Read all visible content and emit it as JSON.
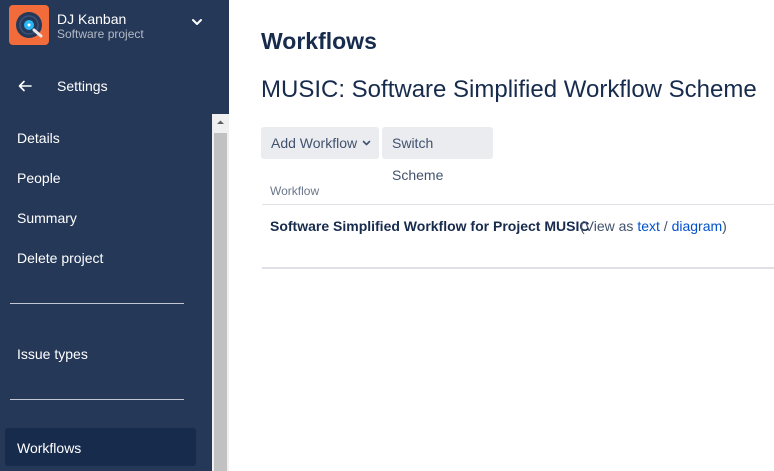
{
  "project": {
    "name": "DJ Kanban",
    "type": "Software project",
    "avatar_color": "#f26b3a"
  },
  "sidebar": {
    "back_label": "Settings",
    "items": [
      {
        "label": "Details"
      },
      {
        "label": "People"
      },
      {
        "label": "Summary"
      },
      {
        "label": "Delete project"
      },
      {
        "label": "Issue types"
      },
      {
        "label": "Workflows",
        "active": true
      }
    ],
    "background": "#253858",
    "active_background": "#172b4d"
  },
  "main": {
    "title": "Workflows",
    "scheme_title": "MUSIC: Software Simplified Workflow Scheme",
    "buttons": {
      "add_workflow": "Add Workflow",
      "switch_scheme": "Switch Scheme"
    },
    "table": {
      "column_header": "Workflow",
      "rows": [
        {
          "name": "Software Simplified Workflow for Project MUSIC",
          "view_prefix": "(View as",
          "view_text_link": "text",
          "separator": "/",
          "view_diagram_link": "diagram",
          "view_suffix": ")"
        }
      ]
    },
    "link_color": "#0052cc"
  }
}
